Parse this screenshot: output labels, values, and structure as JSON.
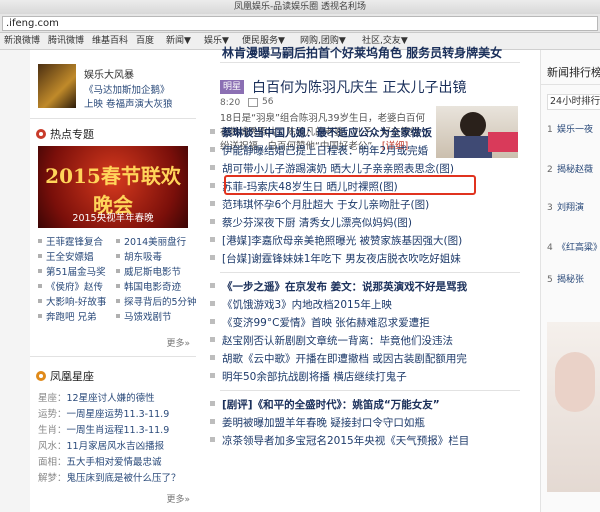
{
  "window": {
    "title": "凤凰娱乐-品读娱乐圈 透视名利场"
  },
  "browser": {
    "url": ".ifeng.com"
  },
  "bookmarks": [
    "新浪微博",
    "腾讯微博",
    "维基百科",
    "百度",
    "新闻▼",
    "娱乐▼",
    "便民服务▼",
    "网购,团购▼",
    "社区,交友▼"
  ],
  "left": {
    "feature": {
      "title": "娱乐大风暴",
      "line1": "《马达加斯加企鹅》",
      "line2": "上映 卷福声演大灰狼"
    },
    "hot": {
      "title": "热点专题",
      "banner_caption": "2015央视羊年春晚",
      "rows": [
        [
          "王菲霆锋复合",
          "2014美丽盘行"
        ],
        [
          "王全安嫖娼",
          "胡东吸毒"
        ],
        [
          "第51届金马奖",
          "威尼斯电影节"
        ],
        [
          "《侯府》赵传",
          "韩国电影奇迹"
        ],
        [
          "大影响-好故事",
          "探寻背后的5分钟"
        ],
        [
          "奔跑吧 兄弟",
          "马馈戏剧节"
        ]
      ],
      "more": "更多»"
    },
    "astro": {
      "title": "凤凰星座",
      "items": [
        {
          "label": "星座：",
          "text": "12星座讨人嫌的德性"
        },
        {
          "label": "运势：",
          "text": "一周星座运势11.3-11.9"
        },
        {
          "label": "生肖：",
          "text": "一周生肖运程11.3-11.9"
        },
        {
          "label": "风水：",
          "text": "11月家居风水吉凶播报"
        },
        {
          "label": "面相：",
          "text": "五大手相对爱情最忠诚"
        },
        {
          "label": "解梦：",
          "text": "鬼压床到底是被什么压了？"
        }
      ],
      "more": "更多»"
    }
  },
  "center": {
    "top_cut": "林肯漫曝马嗣后拍首个好莱坞角色 服务员转身牌美女",
    "headline_tag": "明星",
    "headline": "白百何为陈羽凡庆生 正太儿子出镜",
    "time": "8:20",
    "comments": "56",
    "summary": "18日是“羽泉”组合陈羽凡39岁生日，老婆白百何在微博秀照片，陈羽凡的老婆、儿子、好友等纷纷送祝福，白百何赞他“中国好老公”。",
    "summary_link": "[详细]",
    "news": [
      {
        "text": "蔡琳谈当中国儿媳：最不适应公众为全家做饭",
        "bold": true
      },
      {
        "text": "伊能静曝结婚已提上日程表：明年2月或完婚",
        "bold": false
      },
      {
        "text": "胡可带小儿子游踢演奶 晒大儿子亲亲照表思念(图)",
        "bold": false
      },
      {
        "text": "苏菲-玛索庆48岁生日 晒儿时裸照(图)",
        "bold": false
      },
      {
        "text": "范玮琪怀孕6个月肚超大 于女儿亲吻肚子(图)",
        "bold": false
      },
      {
        "text": "蔡少芬深夜下厨 清秀女儿漂亮似妈妈(图)",
        "bold": false
      },
      {
        "text": "[港媒]李嘉欣母亲美艳照曝光 被赞家族基因强大(图)",
        "bold": false
      },
      {
        "text": "[台媒]谢霆锋妹妹1年吃下 男友夜店脱衣吹吃好姐妹",
        "bold": false
      },
      {
        "text": "《一步之遥》在京发布 姜文：说那英演戏不好是骂我",
        "bold": true
      },
      {
        "text": "《饥饿游戏3》内地改档2015年上映",
        "bold": false
      },
      {
        "text": "《变济99°C爱情》首映 张佑赫难忍求爱遭拒",
        "bold": false
      },
      {
        "text": "赵宝刚否认新剧剧文章统一背离：毕竟他们没违法",
        "bold": false
      },
      {
        "text": "胡歌《云中歌》开播在即遭撤档 或因古装剧配额用完",
        "bold": false
      },
      {
        "text": "明年50余部抗战剧将播 横店继续打鬼子",
        "bold": false
      },
      {
        "text": "[剧评]《和平的全盛时代》：姚笛成“万能女友”",
        "bold": true
      },
      {
        "text": "姜明被曝加盟羊年春晚 疑接封口令守口如瓶",
        "bold": false
      },
      {
        "text": "凉茶领导者加多宝冠名2015年央视《天气预报》栏目",
        "bold": false
      }
    ]
  },
  "right": {
    "title": "新闻排行榜",
    "tab": "24小时排行",
    "items": [
      {
        "num": "1",
        "text": "娱乐一夜"
      },
      {
        "num": "2",
        "text": "揭秘赵薇"
      },
      {
        "num": "3",
        "text": "刘翔演"
      },
      {
        "num": "4",
        "text": "《红高粱》曝光"
      },
      {
        "num": "5",
        "text": "揭秘张"
      }
    ]
  },
  "colors": {
    "accent_red": "#e0331f",
    "link_blue": "#1d3a6a",
    "tag_purple": "#8b6fb3"
  }
}
